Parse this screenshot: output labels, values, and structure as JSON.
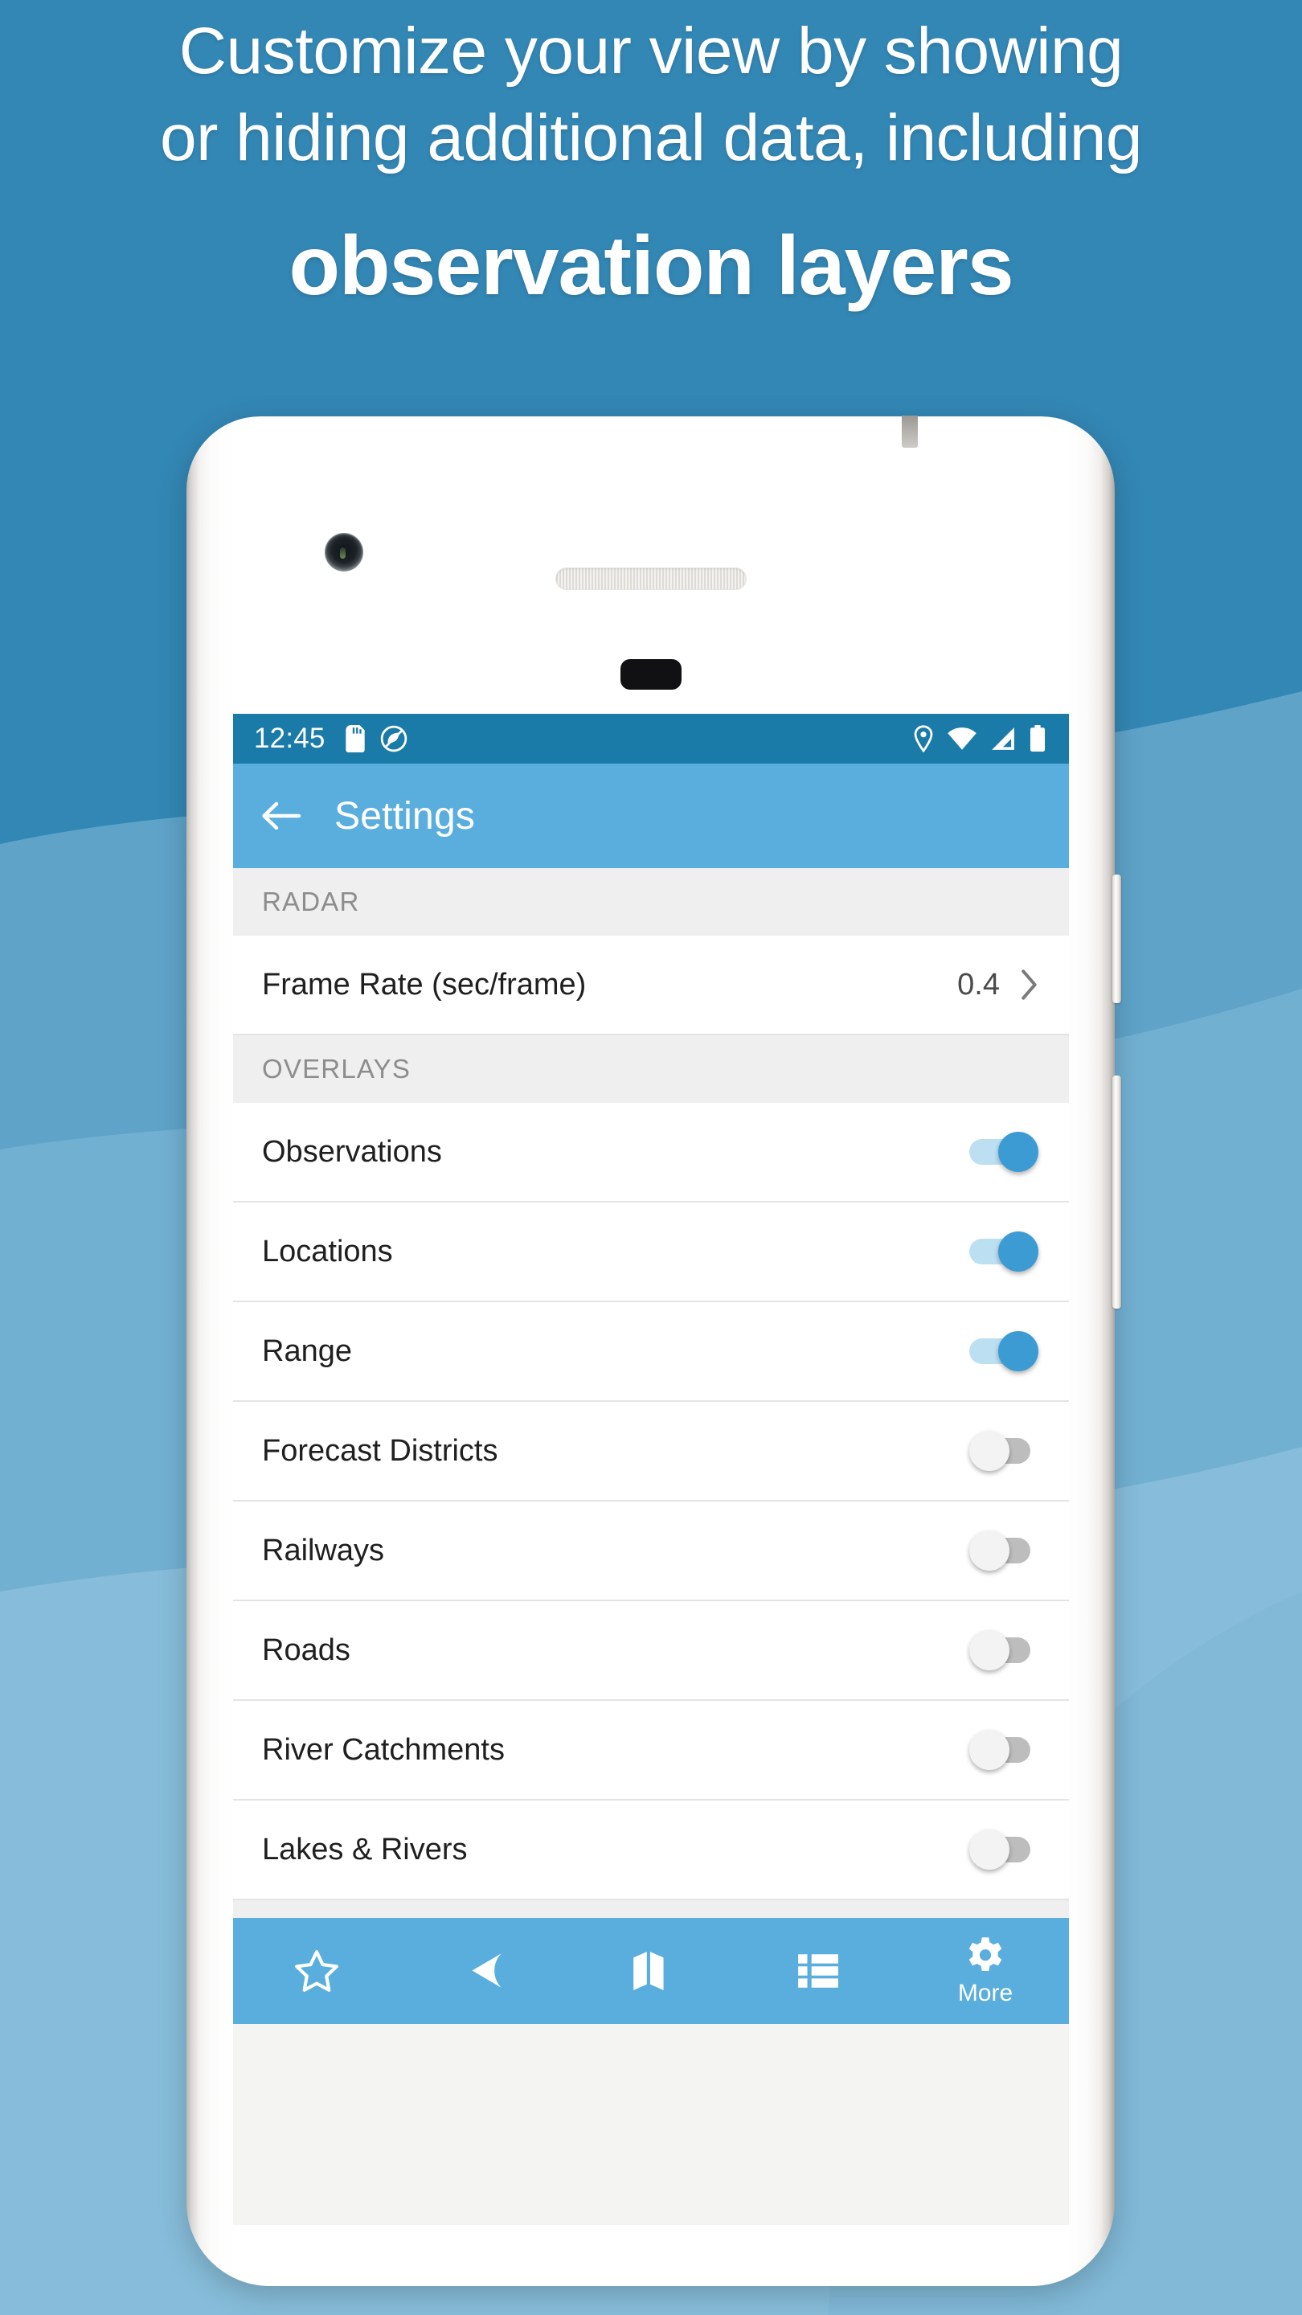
{
  "background": {
    "base_color": "#3387b5",
    "wave_colors": [
      "#5fa3c9",
      "#72b0d2",
      "#87bdda"
    ]
  },
  "headline": {
    "line1": "Customize your view by showing",
    "line2": "or hiding additional data, including",
    "line3": "observation layers",
    "color": "#ffffff"
  },
  "phone": {
    "camera_icon": "camera-icon",
    "speaker_icon": "earpiece-speaker",
    "sensor_icon": "front-sensor",
    "power_button": "power-button",
    "volume_button": "volume-button"
  },
  "status_bar": {
    "time": "12:45",
    "background": "#1a7ba8",
    "left_icons": [
      "sd-card-icon",
      "app-logo-icon"
    ],
    "right_icons": [
      "location-pin-icon",
      "wifi-icon",
      "cell-signal-icon",
      "battery-icon"
    ]
  },
  "app_bar": {
    "back_icon": "back-arrow-icon",
    "title": "Settings",
    "background": "#5aaedd"
  },
  "sections": [
    {
      "header": "RADAR",
      "rows": [
        {
          "label": "Frame Rate (sec/frame)",
          "type": "value",
          "value": "0.4",
          "accessory_icon": "chevron-right-icon"
        }
      ]
    },
    {
      "header": "OVERLAYS",
      "rows": [
        {
          "label": "Observations",
          "type": "switch",
          "state": "on"
        },
        {
          "label": "Locations",
          "type": "switch",
          "state": "on"
        },
        {
          "label": "Range",
          "type": "switch",
          "state": "on"
        },
        {
          "label": "Forecast Districts",
          "type": "switch",
          "state": "off"
        },
        {
          "label": "Railways",
          "type": "switch",
          "state": "off"
        },
        {
          "label": "Roads",
          "type": "switch",
          "state": "off"
        },
        {
          "label": "River Catchments",
          "type": "switch",
          "state": "off"
        },
        {
          "label": "Lakes & Rivers",
          "type": "switch",
          "state": "off"
        }
      ]
    }
  ],
  "switch_colors": {
    "on_track": "#bcdff2",
    "on_thumb": "#3d9bd4",
    "off_track": "#bdbdbd",
    "off_thumb": "#f3f3f3"
  },
  "bottom_nav": {
    "background": "#5aaedd",
    "items": [
      {
        "icon": "star-outline-icon",
        "label": ""
      },
      {
        "icon": "navigation-arrow-icon",
        "label": ""
      },
      {
        "icon": "map-icon",
        "label": ""
      },
      {
        "icon": "list-icon",
        "label": ""
      },
      {
        "icon": "gear-icon",
        "label": "More"
      }
    ]
  }
}
